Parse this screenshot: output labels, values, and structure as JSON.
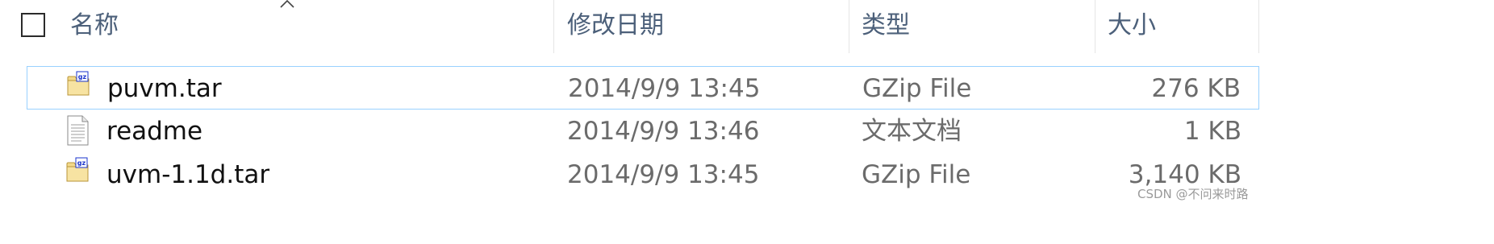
{
  "header": {
    "columns": {
      "name": "名称",
      "modified": "修改日期",
      "type": "类型",
      "size": "大小"
    },
    "sort": {
      "column": "name",
      "direction": "ascending",
      "icon": "chevron-up-icon"
    }
  },
  "files": [
    {
      "name": "puvm.tar",
      "modified": "2014/9/9 13:45",
      "type": "GZip File",
      "size": "276 KB",
      "icon": "gz-archive-icon",
      "selected": true
    },
    {
      "name": "readme",
      "modified": "2014/9/9 13:46",
      "type": "文本文档",
      "size": "1 KB",
      "icon": "text-document-icon",
      "selected": false
    },
    {
      "name": "uvm-1.1d.tar",
      "modified": "2014/9/9 13:45",
      "type": "GZip File",
      "size": "3,140 KB",
      "icon": "gz-archive-icon",
      "selected": false
    }
  ],
  "watermark": "CSDN @不问来时路",
  "colors": {
    "header_text": "#4c607a",
    "name_text": "#111111",
    "meta_text": "#6b6b6b",
    "selection_border": "#99d1ff",
    "archive_icon_label": "#1a33cc"
  }
}
